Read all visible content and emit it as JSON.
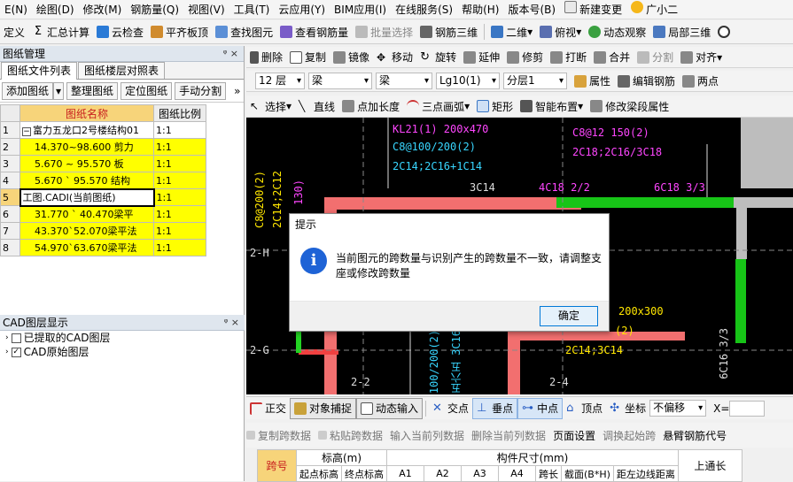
{
  "menu": [
    "E(N)",
    "绘图(D)",
    "修改(M)",
    "钢筋量(Q)",
    "视图(V)",
    "工具(T)",
    "云应用(Y)",
    "BIM应用(I)",
    "在线服务(S)",
    "帮助(H)",
    "版本号(B)",
    "新建变更",
    "广小二"
  ],
  "toolbar1": [
    "定义",
    "汇总计算",
    "云检查",
    "平齐板顶",
    "查找图元",
    "查看钢筋量",
    "批量选择",
    "钢筋三维",
    "二维",
    "俯视",
    "动态观察",
    "局部三维"
  ],
  "left_panel": {
    "title": "图纸管理",
    "pin": "ᵠ ×",
    "tabs": [
      "图纸文件列表",
      "图纸楼层对照表"
    ],
    "buttons": [
      "添加图纸",
      "整理图纸",
      "定位图纸",
      "手动分割"
    ],
    "more": "»",
    "headers": [
      "图纸名称",
      "图纸比例"
    ],
    "rows": [
      {
        "n": "1",
        "name": "富力五龙口2号楼结构01",
        "scale": "1:1",
        "collapse": "−"
      },
      {
        "n": "2",
        "name": "14.370~98.600 剪力",
        "scale": "1:1"
      },
      {
        "n": "3",
        "name": "5.670 ~ 95.570  板",
        "scale": "1:1"
      },
      {
        "n": "4",
        "name": "5.670 ` 95.570 结构",
        "scale": "1:1"
      },
      {
        "n": "5",
        "name": "工图.CADI(当前图纸)",
        "scale": "1:1"
      },
      {
        "n": "6",
        "name": "31.770 ` 40.470梁平",
        "scale": "1:1"
      },
      {
        "n": "7",
        "name": "43.370`52.070梁平法",
        "scale": "1:1"
      },
      {
        "n": "8",
        "name": "54.970`63.670梁平法",
        "scale": "1:1"
      }
    ]
  },
  "cad_layers": {
    "title": "CAD图层显示",
    "items": [
      {
        "label": "已提取的CAD图层",
        "checked": false
      },
      {
        "label": "CAD原始图层",
        "checked": true
      }
    ]
  },
  "toolbar2": [
    "删除",
    "复制",
    "镜像",
    "移动",
    "旋转",
    "延伸",
    "修剪",
    "打断",
    "合并",
    "分割",
    "对齐"
  ],
  "toolbar3": {
    "floor": "12 层",
    "cat": "梁",
    "type": "梁",
    "name": "Lg10(1)",
    "layer": "分层1",
    "props": "属性",
    "edit": "编辑钢筋",
    "two": "两点"
  },
  "toolbar4": [
    "选择",
    "直线",
    "点加长度",
    "三点画弧",
    "矩形",
    "智能布置",
    "修改梁段属性"
  ],
  "cad_texts": {
    "t1": "KL21(1)  200x470",
    "t2": "C8@100/200(2)",
    "t3": "2C14;2C16+1C14",
    "t4": "C8@12  150(2)",
    "t5": "2C18;2C16/3C18",
    "t6": "3C14",
    "t7": "4C18  2/2",
    "t8": "6C18  3/3",
    "t9": "C8@200(2)",
    "t10": "2C14;2C12",
    "t11": "130)",
    "t12": "2-H",
    "t13": "2-G",
    "t14": "2-2",
    "t15": "2-4",
    "t16": "200x300",
    "t17": "(2)",
    "t18": "2C14;3C14",
    "t19": "100/200(2)",
    "t20": "五六五 3C16",
    "t21": "6C16 3/3"
  },
  "dialog": {
    "title": "提示",
    "message": "当前图元的跨数量与识别产生的跨数量不一致，请调整支座或修改跨数量",
    "ok": "确定"
  },
  "snapbar": [
    "正交",
    "对象捕捉",
    "动态输入",
    "交点",
    "垂点",
    "中点",
    "顶点",
    "坐标",
    "不偏移"
  ],
  "xfield": "X=",
  "tablebar": [
    "复制跨数据",
    "粘贴跨数据",
    "输入当前列数据",
    "删除当前列数据",
    "页面设置",
    "调换起始跨",
    "悬臂钢筋代号"
  ],
  "grid_headers": {
    "span": "跨号",
    "elev": "标高(m)",
    "size": "构件尺寸(mm)",
    "top": "上通长",
    "start": "起点标高",
    "end": "终点标高",
    "a1": "A1",
    "a2": "A2",
    "a3": "A3",
    "a4": "A4",
    "len": "跨长",
    "sect": "截面(B*H)",
    "dist": "距左边线距离"
  }
}
